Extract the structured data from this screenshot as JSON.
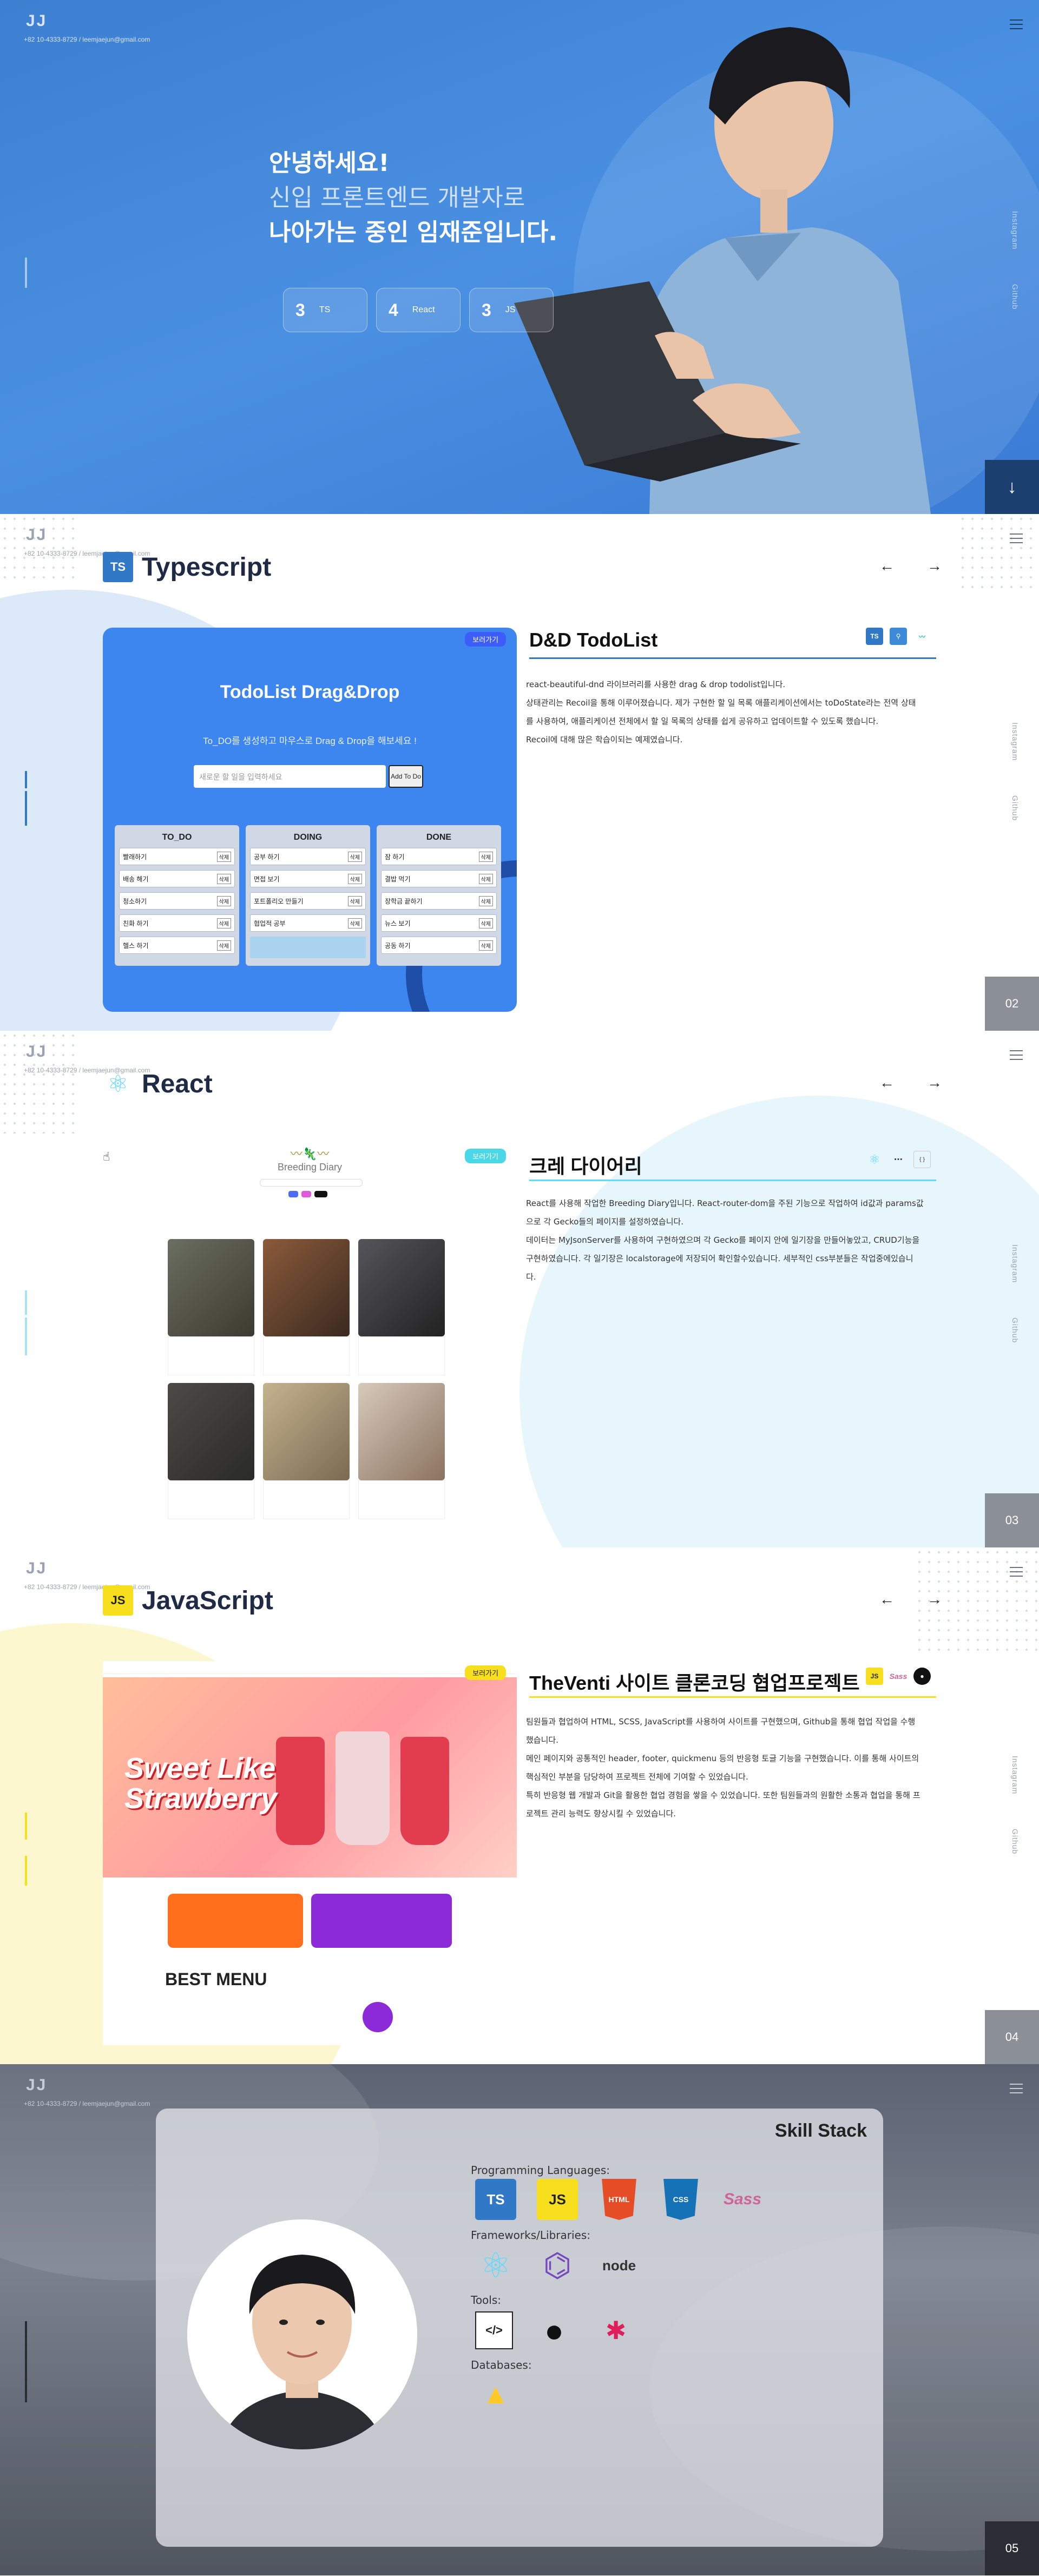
{
  "header": {
    "brand": "JJ",
    "contact": "+82 10-4333-8729 / leemjaejun@gmail.com"
  },
  "social": {
    "instagram": "Instagram",
    "github": "Github"
  },
  "hero": {
    "line1": "안녕하세요!",
    "line2": "신입 프론트엔드 개발자로",
    "line3": "나아가는 중인 임재준입니다.",
    "stats": [
      {
        "num": "3",
        "label": "TS"
      },
      {
        "num": "4",
        "label": "React"
      },
      {
        "num": "3",
        "label": "JS"
      }
    ],
    "scroll_icon": "arrow-down-icon"
  },
  "typescript": {
    "badge": "TS",
    "section_title": "Typescript",
    "visit": "보러가기",
    "project_title": "D&D TodoList",
    "desc": [
      "react-beautiful-dnd 라이브러리를 사용한 drag & drop todolist입니다.",
      "상태관리는 Recoil을 통해 이루어졌습니다. 제가 구현한 할 일 목록 애플리케이션에서는 toDoState라는 전역 상태",
      "를 사용하여, 애플리케이션 전체에서 할 일 목록의 상태를 쉽게 공유하고 업데이트할 수 있도록 했습니다.",
      "Recoil에 대해 많은 학습이되는 예제였습니다."
    ],
    "page": "02",
    "mock": {
      "heading": "TodoList Drag&Drop",
      "subtitle": "To_DO를 생성하고 마우스로 Drag & Drop을 해보세요 !",
      "placeholder": "새로운 할 일을 입력하세요",
      "add": "Add To Do",
      "columns": [
        {
          "name": "TO_DO",
          "items": [
            "빨래하기",
            "배송 해기",
            "청소하기",
            "친화 하기",
            "헬스 하기"
          ]
        },
        {
          "name": "DOING",
          "items": [
            "공부 하기",
            "면접 보기",
            "포트폴리오 만들기",
            "협업적 공부",
            ""
          ]
        },
        {
          "name": "DONE",
          "items": [
            "잠 하기",
            "결밥 먹기",
            "장학금 끝하기",
            "뉴스 보기",
            "공동 하기"
          ]
        }
      ],
      "delete": "삭제"
    }
  },
  "react": {
    "section_title": "React",
    "visit": "보러가기",
    "project_title": "크레 다이어리",
    "desc": [
      "React를 사용해 작업한 Breeding Diary입니다. React-router-dom을 주된 기능으로 작업하여 id값과 params값",
      "으로 각 Gecko들의 페이지를 설정하였습니다.",
      "데이터는 MyJsonServer를 사용하여 구현하였으며 각 Gecko를 페이지 안에 일기장을 만들어놓았고, CRUD기능을",
      "구현하였습니다. 각 일기장은 localstorage에 저장되어 확인할수있습니다. 세부적인 css부분들은 작업중에있습니",
      "다."
    ],
    "page": "03",
    "mock": {
      "name": "Breeding Diary"
    }
  },
  "javascript": {
    "badge": "JS",
    "section_title": "JavaScript",
    "visit": "보러가기",
    "project_title": "TheVenti 사이트 클론코딩 협업프로젝트",
    "desc": [
      "팀원들과 협업하여 HTML, SCSS, JavaScript를 사용하여 사이트를 구현했으며, Github을 통해 협업 작업을 수행",
      "했습니다.",
      "메인 페이지와 공통적인 header, footer, quickmenu 등의 반응형 토글 기능을 구현했습니다. 이를 통해 사이트의",
      "핵심적인 부분을 담당하여 프로젝트 전체에 기여할 수 있었습니다.",
      "특히 반응형 웹 개발과 Git을 활용한 협업 경험을 쌓을 수 있었습니다. 또한 팀원들과의 원활한 소통과 협업을 통해 프",
      "로젝트 관리 능력도 향상시킬 수 있었습니다."
    ],
    "page": "04",
    "mock": {
      "slogan1": "Sweet Like",
      "slogan2": "Strawberry",
      "best": "BEST MENU"
    }
  },
  "skill": {
    "title": "Skill Stack",
    "categories": [
      {
        "label": "Programming Languages:",
        "icons": [
          "TS",
          "JS",
          "HTML",
          "CSS",
          "Sass"
        ]
      },
      {
        "label": "Frameworks/Libraries:",
        "icons": [
          "React",
          "Redux",
          "node"
        ]
      },
      {
        "label": "Tools:",
        "icons": [
          "VSCode",
          "GitHub",
          "Slack"
        ]
      },
      {
        "label": "Databases:",
        "icons": [
          "Firebase"
        ]
      }
    ],
    "page": "05"
  },
  "colors": {
    "hero_bg": "#4a90e2",
    "ts_blue": "#3178c6",
    "js_yellow": "#f7df1e",
    "react_cyan": "#61dafb",
    "page_num_bg": "#8b8f96"
  }
}
